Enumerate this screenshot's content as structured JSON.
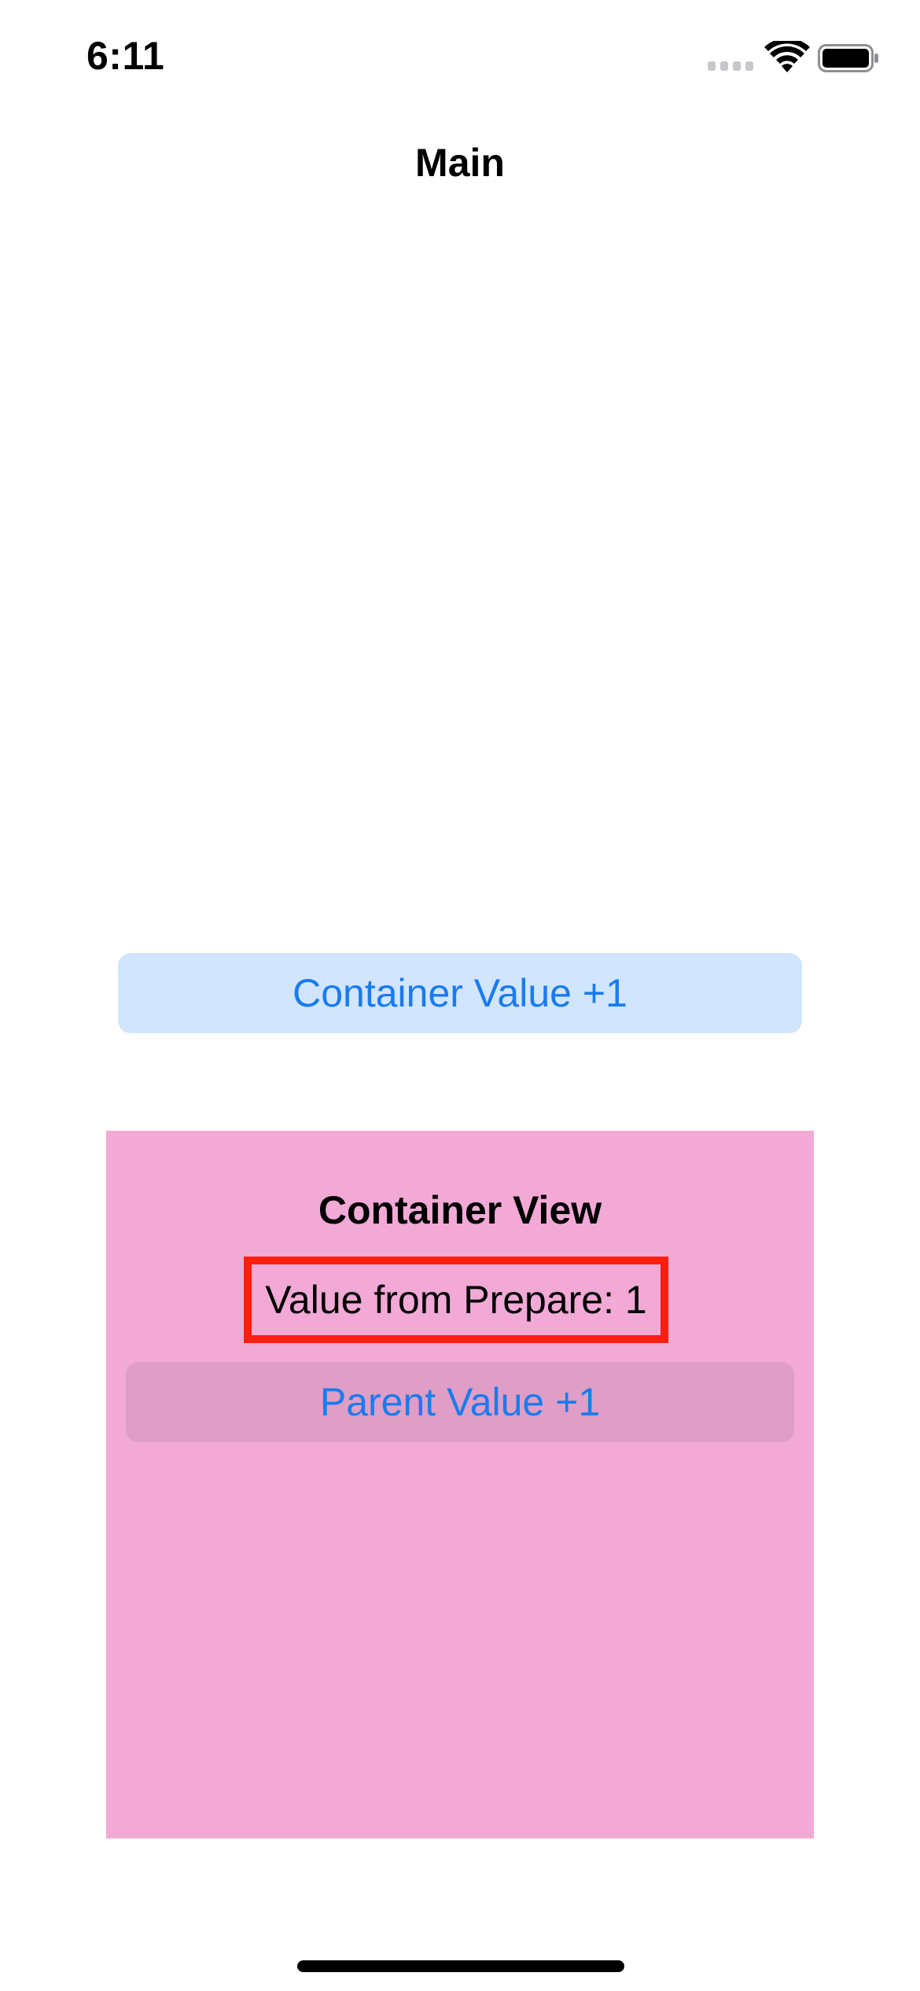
{
  "status_bar": {
    "time": "6:11",
    "signal_icon": "cellular-signal-icon",
    "wifi_icon": "wifi-icon",
    "battery_icon": "battery-full-icon"
  },
  "nav": {
    "title": "Main"
  },
  "main": {
    "container_value_button_label": "Container Value +1"
  },
  "container": {
    "title": "Container View",
    "prepare_label": "Value from Prepare: 1",
    "parent_value_button_label": "Parent Value +1"
  },
  "colors": {
    "accent": "#1a7bef",
    "container_background": "#f2a9d6",
    "highlight_border": "#fd1f0e",
    "button_tint": "#d1e5fd"
  }
}
